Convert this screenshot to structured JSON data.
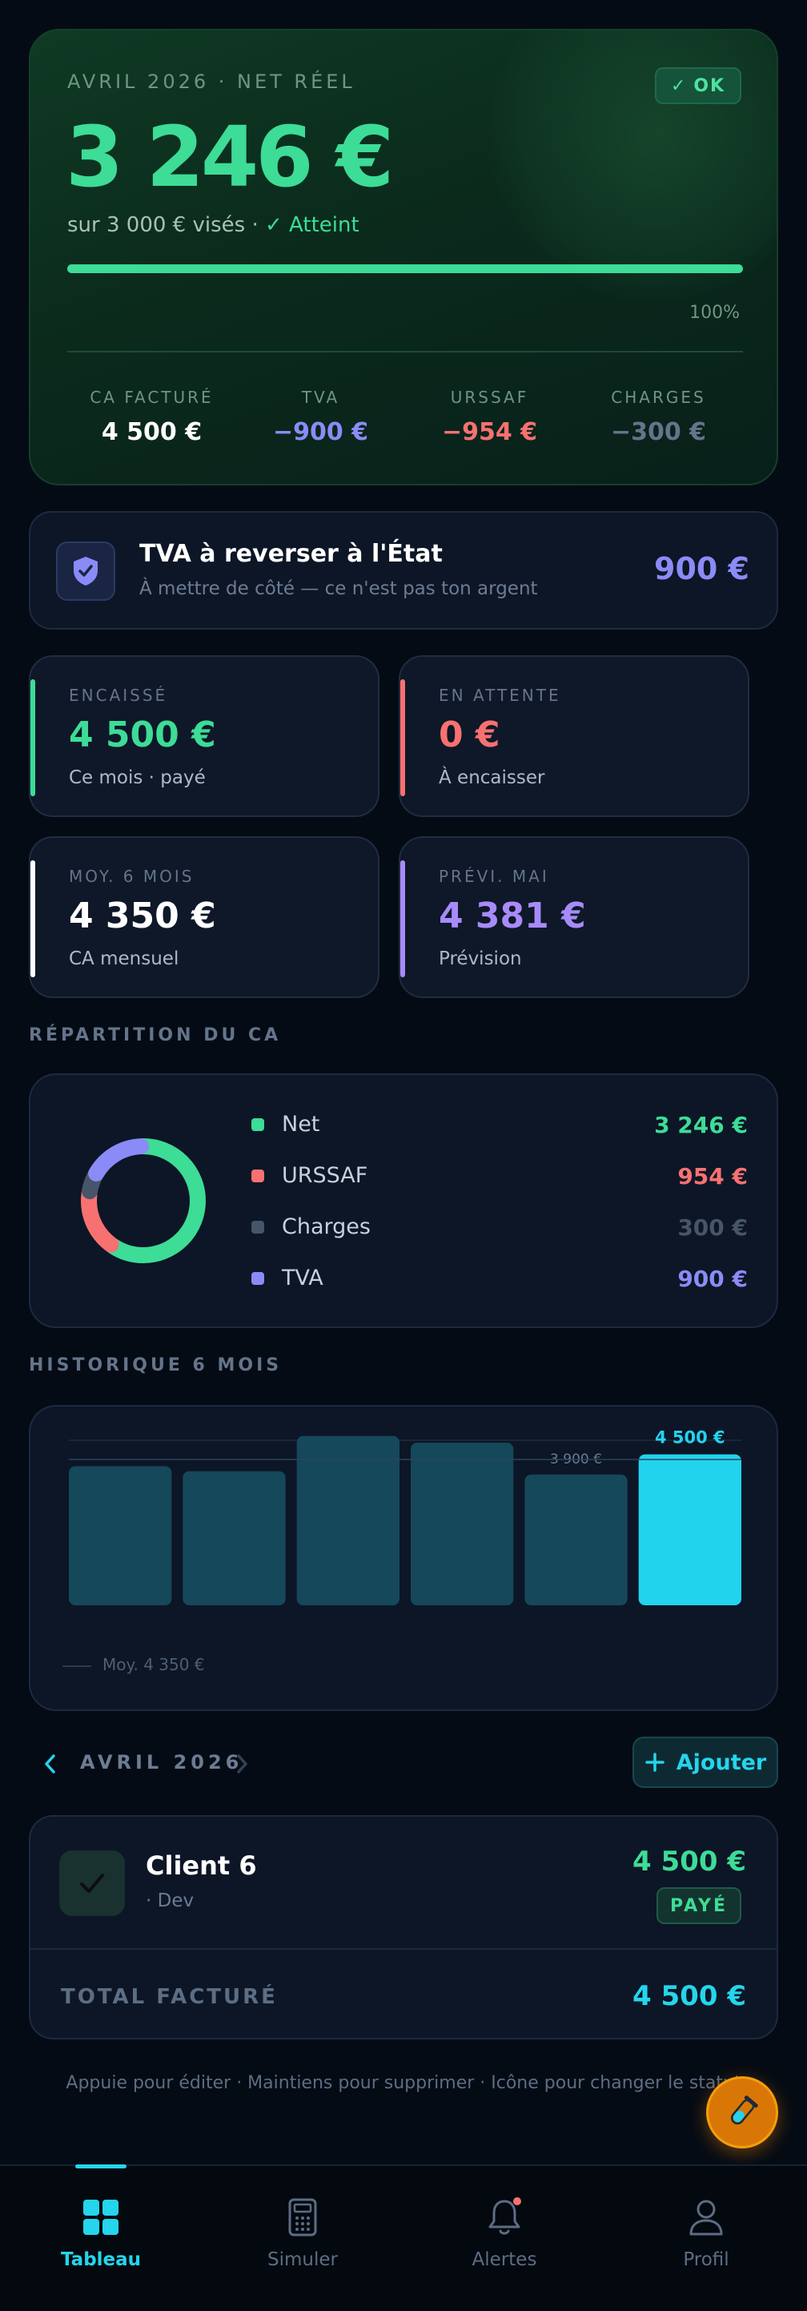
{
  "hero": {
    "label": "AVRIL 2026 · NET RÉEL",
    "badge": "OK",
    "amount": "3 246 €",
    "sub_prefix": "sur 3 000 € visés ·",
    "sub_status": "Atteint",
    "progress": 1.0,
    "progress_label": "100%",
    "stats": [
      {
        "label": "CA FACTURÉ",
        "value": "4 500 €",
        "color": "#ffffff"
      },
      {
        "label": "TVA",
        "value": "−900 €",
        "color": "#8b8bf7"
      },
      {
        "label": "URSSAF",
        "value": "−954 €",
        "color": "#f87171"
      },
      {
        "label": "CHARGES",
        "value": "−300 €",
        "color": "#64748b"
      }
    ]
  },
  "tva": {
    "title": "TVA à reverser à l'État",
    "subtitle": "À mettre de côté — ce n'est pas ton argent",
    "amount": "900 €"
  },
  "kpis": [
    {
      "label": "ENCAISSÉ",
      "value": "4 500 €",
      "sub": "Ce mois · payé",
      "color": "#3ddc97"
    },
    {
      "label": "EN ATTENTE",
      "value": "0 €",
      "sub": "À encaisser",
      "color": "#f87171"
    },
    {
      "label": "MOY. 6 MOIS",
      "value": "4 350 €",
      "sub": "CA mensuel",
      "color": "#ffffff"
    },
    {
      "label": "PRÉVI. MAI",
      "value": "4 381 €",
      "sub": "Prévision",
      "color": "#a78bfa"
    }
  ],
  "repartition": {
    "title": "RÉPARTITION DU CA",
    "items": [
      {
        "name": "Net",
        "value": "3 246 €",
        "amount": 3246,
        "color": "#3ddc97"
      },
      {
        "name": "URSSAF",
        "value": "954 €",
        "amount": 954,
        "color": "#f87171"
      },
      {
        "name": "Charges",
        "value": "300 €",
        "amount": 300,
        "color": "#475569"
      },
      {
        "name": "TVA",
        "value": "900 €",
        "amount": 900,
        "color": "#8b8bf7"
      }
    ]
  },
  "historique": {
    "title": "HISTORIQUE 6 MOIS",
    "avg_label": "Moy. 4 350 €",
    "chart_data": {
      "type": "bar",
      "values": [
        4150,
        4000,
        5050,
        4850,
        3900,
        4500
      ],
      "labels": [
        "",
        "",
        "",
        "",
        "3 900 €",
        "4 500 €"
      ],
      "highlight_index": 5,
      "avg": 4350,
      "ylim": [
        0,
        5400
      ],
      "colors": {
        "bar": "#15485a",
        "highlight": "#22d3ee"
      }
    }
  },
  "month_nav": {
    "label": "AVRIL 2026",
    "add_label": "Ajouter"
  },
  "invoice": {
    "client": "Client 6",
    "meta": "· Dev",
    "amount": "4 500 €",
    "status": "PAYÉ",
    "total_label": "TOTAL FACTURÉ",
    "total_value": "4 500 €"
  },
  "hint": "Appuie pour éditer · Maintiens pour supprimer · Icône pour changer le statut",
  "nav": [
    {
      "label": "Tableau",
      "icon": "dashboard-grid-icon",
      "active": true
    },
    {
      "label": "Simuler",
      "icon": "calculator-icon",
      "active": false
    },
    {
      "label": "Alertes",
      "icon": "bell-icon",
      "active": false
    },
    {
      "label": "Profil",
      "icon": "user-icon",
      "active": false
    }
  ]
}
